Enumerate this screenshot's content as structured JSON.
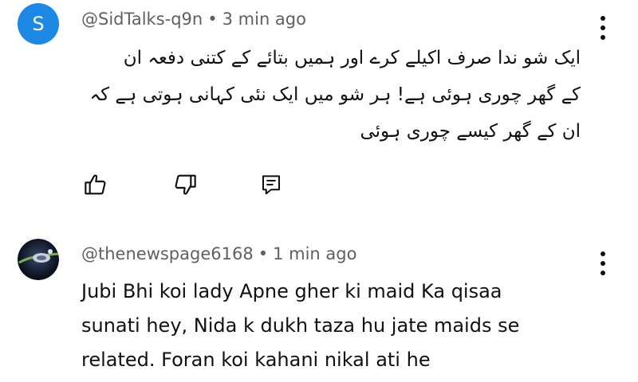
{
  "comments": [
    {
      "avatar_letter": "S",
      "avatar_color": "#1e88e5",
      "author": "@SidTalks-q9n",
      "separator": "•",
      "time": "3 min ago",
      "lines": [
        "ایک شو ندا صرف اکیلے کرے اور ہمیں بتائے کے کتنی دفعہ ان",
        "کے گھر چوری ہوئی ہے! ہر شو میں ایک نئی کہانی ہوتی ہے کہ",
        "ان کے گھر کیسے چوری ہوئی"
      ],
      "actions": [
        "like-icon",
        "dislike-icon",
        "reply-icon"
      ],
      "menu_icon": "more-vert-icon"
    },
    {
      "avatar_icon": "channel-avatar-image",
      "author": "@thenewspage6168",
      "separator": "•",
      "time": "1 min ago",
      "lines": [
        "Jubi Bhi koi lady Apne gher ki maid Ka qisaa",
        "sunati hey, Nida k dukh taza hu jate maids se",
        "related. Foran koi kahani nikal ati he"
      ],
      "menu_icon": "more-vert-icon"
    }
  ]
}
